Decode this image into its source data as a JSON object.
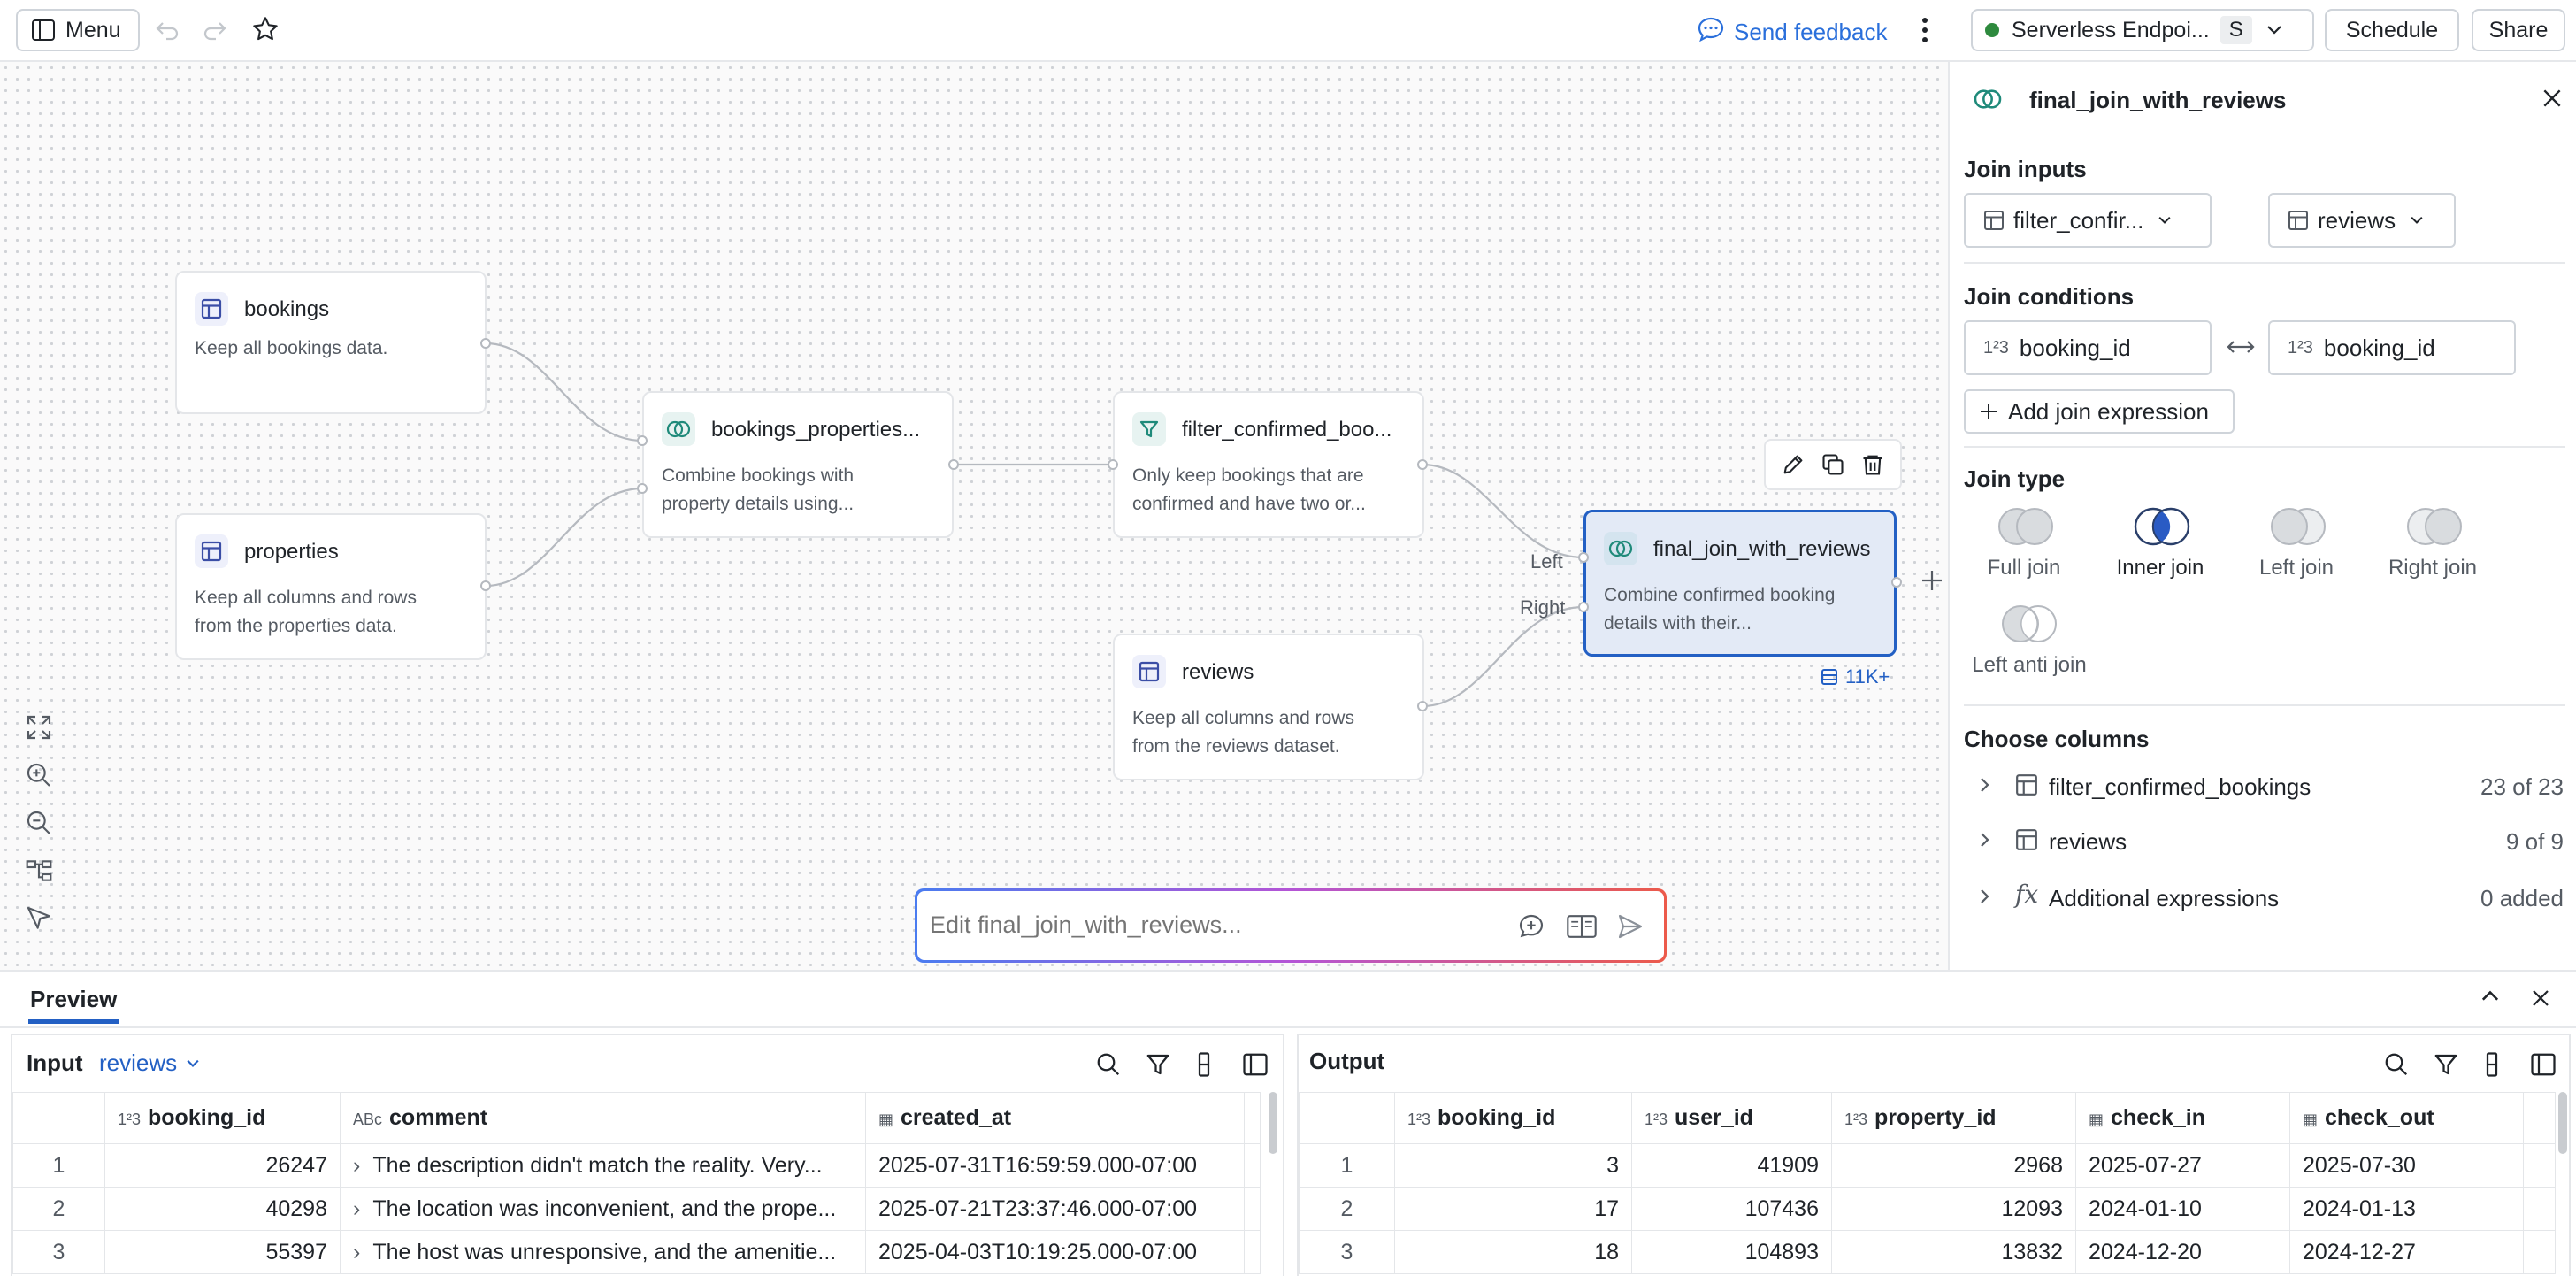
{
  "topbar": {
    "menu_label": "Menu",
    "send_feedback": "Send feedback",
    "endpoint_label": "Serverless Endpoi...",
    "endpoint_badge": "S",
    "schedule_label": "Schedule",
    "share_label": "Share"
  },
  "nodes": {
    "bookings": {
      "title": "bookings",
      "desc": "Keep all bookings data."
    },
    "properties": {
      "title": "properties",
      "desc1": "Keep all columns and rows",
      "desc2": "from the properties data."
    },
    "bookings_properties": {
      "title": "bookings_properties...",
      "desc1": "Combine bookings with",
      "desc2": "property details using..."
    },
    "filter": {
      "title": "filter_confirmed_boo...",
      "desc1": "Only keep bookings that are",
      "desc2": "confirmed and have two or..."
    },
    "reviews": {
      "title": "reviews",
      "desc1": "Keep all columns and rows",
      "desc2": "from the reviews dataset."
    },
    "final": {
      "title": "final_join_with_reviews",
      "desc1": "Combine confirmed booking",
      "desc2": "details with their...",
      "row_count": "11K+"
    },
    "left_label": "Left",
    "right_label": "Right"
  },
  "chat": {
    "placeholder": "Edit final_join_with_reviews..."
  },
  "panel": {
    "title": "final_join_with_reviews",
    "join_inputs_heading": "Join inputs",
    "left_input": "filter_confir...",
    "right_input": "reviews",
    "join_conditions_heading": "Join conditions",
    "left_condition": "booking_id",
    "right_condition": "booking_id",
    "add_join_expression": "Add join expression",
    "join_type_heading": "Join type",
    "join_types": [
      "Full join",
      "Inner join",
      "Left join",
      "Right join",
      "Left anti join"
    ],
    "selected_join_type": "Inner join",
    "choose_columns_heading": "Choose columns",
    "column_groups": [
      {
        "name": "filter_confirmed_bookings",
        "count": "23 of 23"
      },
      {
        "name": "reviews",
        "count": "9 of 9"
      },
      {
        "name": "Additional expressions",
        "count": "0 added"
      }
    ]
  },
  "preview": {
    "tab_label": "Preview",
    "input_label": "Input",
    "input_dataset": "reviews",
    "output_label": "Output",
    "input_table": {
      "columns": [
        {
          "type": "1²3",
          "name": "booking_id"
        },
        {
          "type": "ABc",
          "name": "comment"
        },
        {
          "type": "cal",
          "name": "created_at"
        }
      ],
      "rows": [
        [
          "1",
          "26247",
          "The description didn't match the reality. Very...",
          "2025-07-31T16:59:59.000-07:00"
        ],
        [
          "2",
          "40298",
          "The location was inconvenient, and the prope...",
          "2025-07-21T23:37:46.000-07:00"
        ],
        [
          "3",
          "55397",
          "The host was unresponsive, and the amenitie...",
          "2025-04-03T10:19:25.000-07:00"
        ]
      ]
    },
    "output_table": {
      "columns": [
        {
          "type": "1²3",
          "name": "booking_id"
        },
        {
          "type": "1²3",
          "name": "user_id"
        },
        {
          "type": "1²3",
          "name": "property_id"
        },
        {
          "type": "cal",
          "name": "check_in"
        },
        {
          "type": "cal",
          "name": "check_out"
        }
      ],
      "rows": [
        [
          "1",
          "3",
          "41909",
          "2968",
          "2025-07-27",
          "2025-07-30"
        ],
        [
          "2",
          "17",
          "107436",
          "12093",
          "2024-01-10",
          "2024-01-13"
        ],
        [
          "3",
          "18",
          "104893",
          "13832",
          "2024-12-20",
          "2024-12-27"
        ]
      ]
    }
  },
  "colors": {
    "accent": "#2a6fdb",
    "selected_node_bg": "#e3eaf6",
    "selected_node_border": "#2360c4",
    "teal_icon": "#1f8a7a"
  }
}
